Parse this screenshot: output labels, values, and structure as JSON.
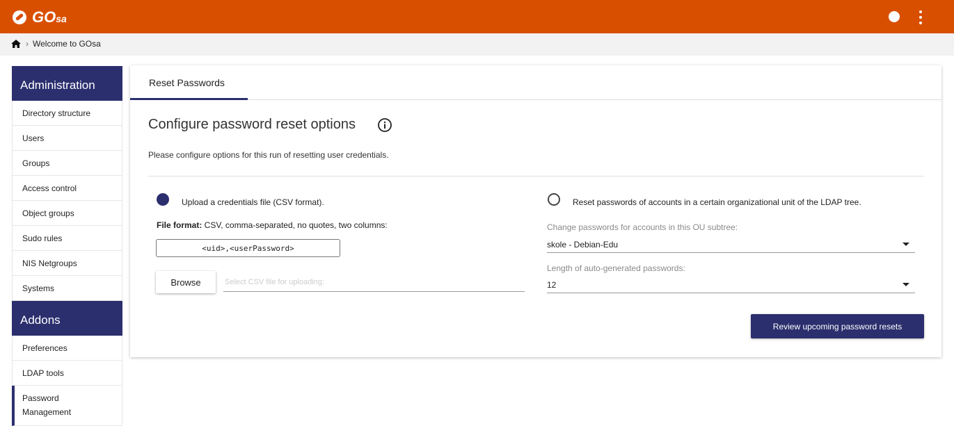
{
  "app": {
    "logo_main": "GO",
    "logo_sub": "sa"
  },
  "breadcrumb": {
    "separator": "›",
    "current": "Welcome to GOsa"
  },
  "sidebar": {
    "sections": [
      {
        "heading": "Administration",
        "items": [
          "Directory structure",
          "Users",
          "Groups",
          "Access control",
          "Object groups",
          "Sudo rules",
          "NIS Netgroups",
          "Systems"
        ]
      },
      {
        "heading": "Addons",
        "items": [
          "Preferences",
          "LDAP tools"
        ]
      }
    ],
    "active_item_line1": "Password",
    "active_item_line2": "Management"
  },
  "main": {
    "tab_label": "Reset Passwords",
    "title": "Configure password reset options",
    "description": "Please configure options for this run of resetting user credentials.",
    "option_upload": {
      "label": "Upload a credentials file (CSV format).",
      "selected": true,
      "format_label": "File format:",
      "format_text": " CSV, comma-separated, no quotes, two columns:",
      "format_example": "<uid>,<userPassword>",
      "browse_label": "Browse",
      "file_placeholder": "Select CSV file for uploading:"
    },
    "option_ou": {
      "label": "Reset passwords of accounts in a certain organizational unit of the LDAP tree.",
      "selected": false,
      "ou_label": "Change passwords for accounts in this OU subtree:",
      "ou_value": "skole - Debian-Edu",
      "length_label": "Length of auto-generated passwords:",
      "length_value": "12"
    },
    "review_button": "Review upcoming password resets"
  },
  "colors": {
    "topbar": "#d94f00",
    "primary": "#2b2f6e"
  }
}
